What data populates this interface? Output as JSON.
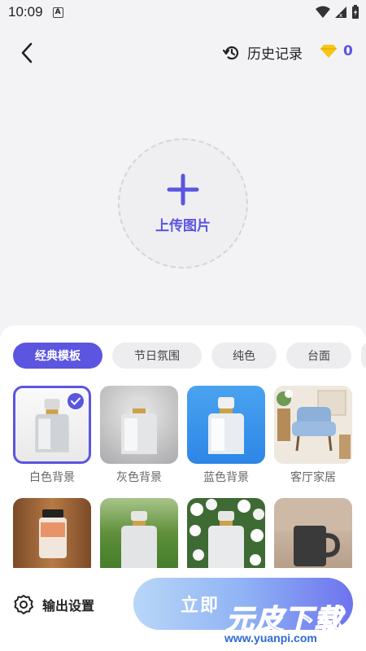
{
  "status": {
    "time": "10:09",
    "notif": "A"
  },
  "header": {
    "history_label": "历史记录",
    "diamond_count": "0"
  },
  "upload": {
    "label": "上传图片"
  },
  "tabs": [
    {
      "label": "经典模板",
      "active": true
    },
    {
      "label": "节日氛围",
      "active": false
    },
    {
      "label": "纯色",
      "active": false
    },
    {
      "label": "台面",
      "active": false
    }
  ],
  "templates": [
    {
      "label": "白色背景",
      "selected": true
    },
    {
      "label": "灰色背景",
      "selected": false
    },
    {
      "label": "蓝色背景",
      "selected": false
    },
    {
      "label": "客厅家居",
      "selected": false
    },
    {
      "label": "",
      "selected": false
    },
    {
      "label": "",
      "selected": false
    },
    {
      "label": "",
      "selected": false
    },
    {
      "label": "",
      "selected": false
    }
  ],
  "bottom": {
    "settings_label": "输出设置",
    "action_label": "立即"
  },
  "watermark": {
    "main": "元皮下载",
    "sub": "www.yuanpi.com"
  },
  "colors": {
    "accent": "#5b55e0",
    "diamond": "#f5c518"
  }
}
